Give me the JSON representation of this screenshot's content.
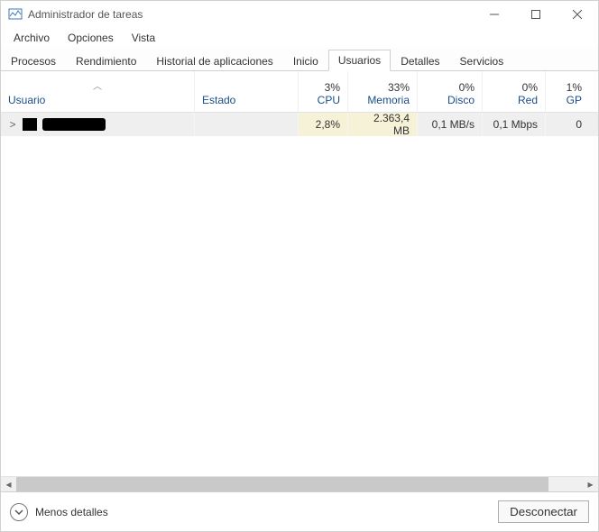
{
  "window": {
    "title": "Administrador de tareas"
  },
  "menu": {
    "file": "Archivo",
    "options": "Opciones",
    "view": "Vista"
  },
  "tabs": {
    "processes": "Procesos",
    "performance": "Rendimiento",
    "app_history": "Historial de aplicaciones",
    "startup": "Inicio",
    "users": "Usuarios",
    "details": "Detalles",
    "services": "Servicios",
    "active": "users"
  },
  "columns": {
    "user": "Usuario",
    "status": "Estado",
    "cpu_pct": "3%",
    "cpu_label": "CPU",
    "mem_pct": "33%",
    "mem_label": "Memoria",
    "disk_pct": "0%",
    "disk_label": "Disco",
    "net_pct": "0%",
    "net_label": "Red",
    "gpu_pct": "1%",
    "gpu_label": "GP"
  },
  "rows": [
    {
      "user": "",
      "status": "",
      "cpu": "2,8%",
      "mem": "2.363,4 MB",
      "disk": "0,1 MB/s",
      "net": "0,1 Mbps",
      "gpu": "0"
    }
  ],
  "footer": {
    "fewer_details": "Menos detalles",
    "disconnect": "Desconectar"
  }
}
